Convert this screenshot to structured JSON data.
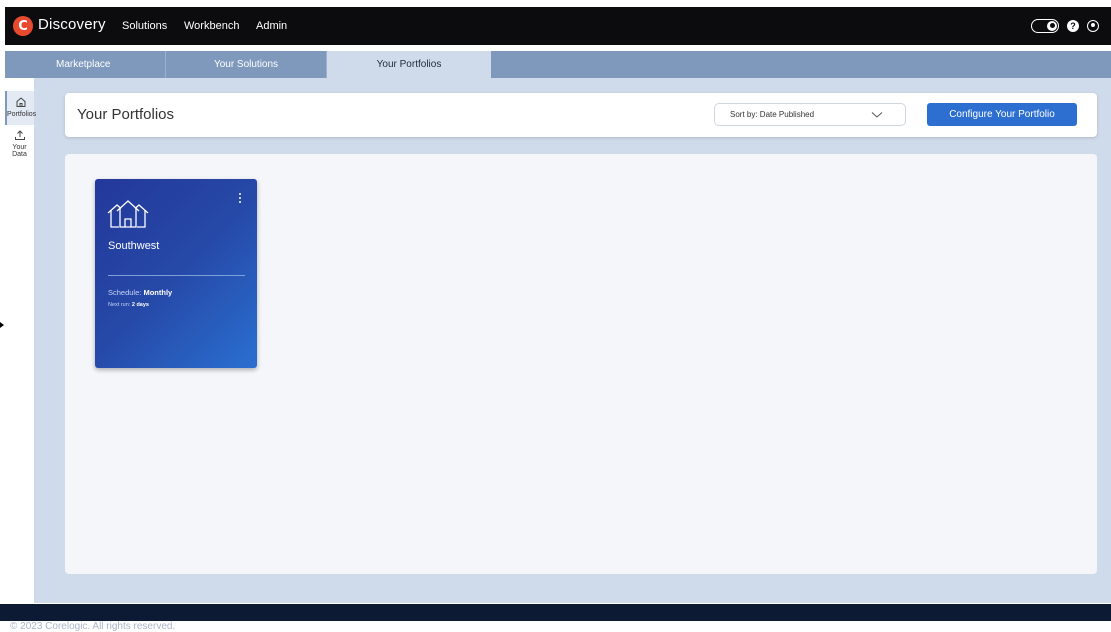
{
  "topbar": {
    "logo_letter": "C",
    "brand": "Discovery",
    "nav": [
      "Solutions",
      "Workbench",
      "Admin"
    ],
    "help_glyph": "?",
    "theme_toggle_icon": "theme-toggle-icon",
    "user_icon": "user-icon"
  },
  "tabs": [
    {
      "label": "Marketplace",
      "active": false
    },
    {
      "label": "Your Solutions",
      "active": false
    },
    {
      "label": "Your Portfolios",
      "active": true
    }
  ],
  "sidebar": {
    "items": [
      {
        "label": "Portfolios",
        "icon": "home-icon",
        "active": true
      },
      {
        "label": "Your Data",
        "icon": "upload-icon",
        "active": false
      }
    ]
  },
  "header": {
    "title": "Your Portfolios",
    "sort_label": "Sort by: Date Published",
    "configure_label": "Configure Your Portfolio"
  },
  "portfolio_card": {
    "title": "Southwest",
    "schedule_label": "Schedule:",
    "schedule_value": "Monthly",
    "next_run_label": "Next run:",
    "next_run_value": "2 days",
    "icon": "houses-icon"
  },
  "footer": {
    "text": "© 2023 Corelogic. All rights reserved."
  },
  "colors": {
    "topbar": "#0c0c0e",
    "tabbar": "#7f99bd",
    "active_tab": "#cfdaea",
    "accent_button": "#2c6fd1",
    "card_gradient_start": "#23389a",
    "card_gradient_end": "#2a6fd0"
  }
}
